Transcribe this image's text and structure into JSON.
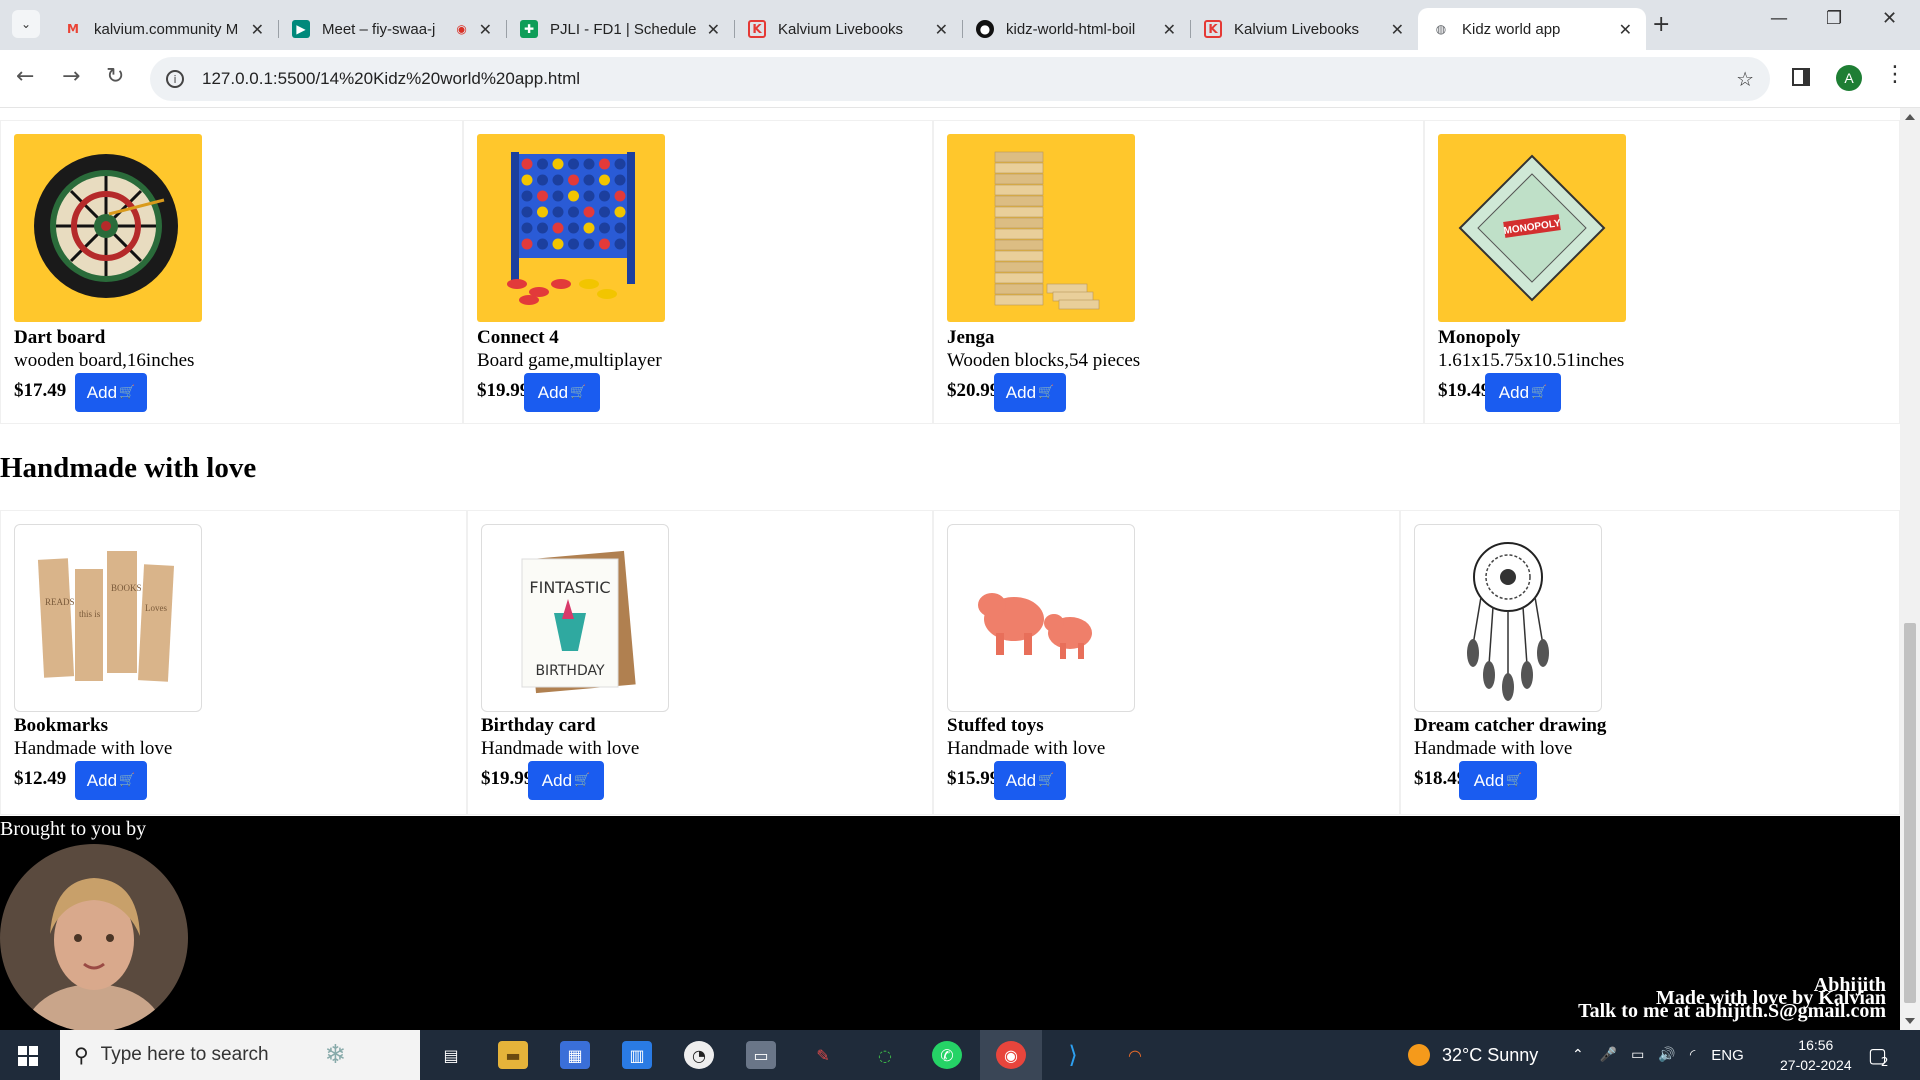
{
  "browser": {
    "tabs": [
      {
        "title": "kalvium.community M",
        "icon": "gmail-icon",
        "color": "#ea4335"
      },
      {
        "title": "Meet – fiy-swaa-j",
        "icon": "meet-icon",
        "color": "#00897b"
      },
      {
        "title": "PJLI - FD1 | Schedule",
        "icon": "sheets-icon",
        "color": "#0f9d58"
      },
      {
        "title": "Kalvium Livebooks",
        "icon": "kalvium-icon",
        "color": "#e53935"
      },
      {
        "title": "kidz-world-html-boil",
        "icon": "github-icon",
        "color": "#111111"
      },
      {
        "title": "Kalvium Livebooks",
        "icon": "kalvium-icon",
        "color": "#e53935"
      },
      {
        "title": "Kidz world app",
        "icon": "globe-icon",
        "color": "#5f6368"
      }
    ],
    "url": "127.0.0.1:5500/14%20Kidz%20world%20app.html",
    "profile_initial": "A"
  },
  "page": {
    "add_label": "Add",
    "button_color": "#1a5cf0",
    "games": [
      {
        "name": "Dart board",
        "desc": "wooden board,16inches",
        "price": "$17.49",
        "image": "dartboard"
      },
      {
        "name": "Connect 4",
        "desc": "Board game,multiplayer",
        "price": "$19.99",
        "image": "connect4"
      },
      {
        "name": "Jenga",
        "desc": "Wooden blocks,54 pieces",
        "price": "$20.99",
        "image": "jenga"
      },
      {
        "name": "Monopoly",
        "desc": "1.61x15.75x10.51inches",
        "price": "$19.49",
        "image": "monopoly"
      }
    ],
    "handmade_title": "Handmade with love",
    "handmade": [
      {
        "name": "Bookmarks",
        "desc": "Handmade with love",
        "price": "$12.49",
        "image": "bookmarks"
      },
      {
        "name": "Birthday card",
        "desc": "Handmade with love",
        "price": "$19.99",
        "image": "birthday-card"
      },
      {
        "name": "Stuffed toys",
        "desc": "Handmade with love",
        "price": "$15.99",
        "image": "stuffed-toys"
      },
      {
        "name": "Dream catcher drawing",
        "desc": "Handmade with love",
        "price": "$18.49",
        "image": "dreamcatcher"
      }
    ],
    "footer": {
      "brought_by": "Brought to you by",
      "author": "Abhijith",
      "made_with": "Made with love by Kalvian",
      "contact": "Talk to me at abhijith.S@gmail.com"
    }
  },
  "taskbar": {
    "search_placeholder": "Type here to search",
    "weather": "32°C  Sunny",
    "language": "ENG",
    "time": "16:56",
    "date": "27-02-2024",
    "notifications": "2"
  }
}
